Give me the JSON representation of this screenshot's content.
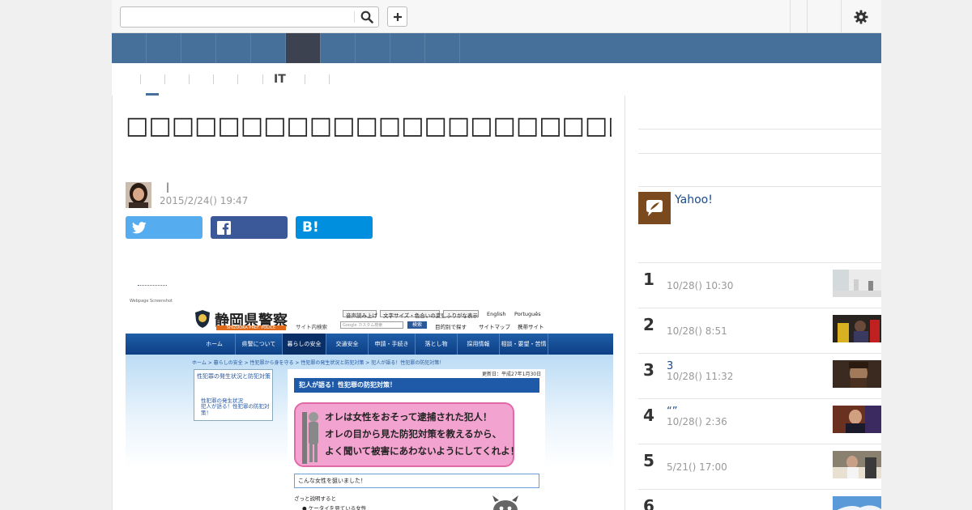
{
  "topbar": {
    "search_placeholder": "",
    "search_icon": "search-icon",
    "add_icon": "plus-icon",
    "settings_icon": "gear-icon"
  },
  "bluenav": {
    "active_index": 5,
    "cell_count": 10
  },
  "subnav": {
    "items": [
      "",
      "",
      "",
      "",
      "",
      "IT",
      ""
    ]
  },
  "article": {
    "title": "□□□□□□□□□□□□□□□□□□□□□□□□□□□□□□□□□",
    "author_divider": "|",
    "date": "2015/2/24() 19:47",
    "share_buttons": {
      "twitter_icon": "twitter-icon",
      "facebook_icon": "facebook-icon",
      "hatena_label": "B!"
    },
    "embedded_screenshot": {
      "caption": "Webpage Screenshot",
      "site_title": "静岡県警察",
      "site_subtitle": "SHIZUOKA PREF. POLICE",
      "util_links": [
        "音声読み上げ",
        "文字サイズ・色合いの変更",
        "ふりがな表示",
        "English",
        "Português"
      ],
      "search_label": "サイト内検索",
      "search_placeholder": "Google カスタム検索",
      "search_button": "検索",
      "util_links2": [
        "目的別で探す",
        "サイトマップ",
        "携帯サイト"
      ],
      "tabs": [
        "ホーム",
        "県警について",
        "暮らしの安全",
        "交通安全",
        "申請・手続き",
        "落とし物",
        "採用情報",
        "相談・要望・苦情"
      ],
      "selected_tab": 2,
      "breadcrumb": "ホーム > 暮らしの安全 > 性犯罪から身を守る > 性犯罪の発生状況と防犯対策 > 犯人が語る！性犯罪の防犯対策！",
      "side_heading": "性犯罪の発生状況と防犯対策",
      "side_links": [
        "性犯罪の発生状況",
        "犯人が語る！性犯罪の防犯対策！"
      ],
      "updated": "更新日：平成27年1月30日",
      "main_heading": "犯人が語る！性犯罪の防犯対策！",
      "pink_lines": [
        "オレは女性をおそって逮捕された犯人！",
        "オレの目から見た防犯対策を教えるから、",
        "よく聞いて被害にあわないようにしてくれよ！"
      ],
      "sub_heading": "こんな女性を狙いました！",
      "para1": "ざっと説明すると",
      "para2": "● ケータイを見ている女性"
    }
  },
  "sidebar": {
    "yahoo_label": "Yahoo!",
    "yahoo_icon": "feather-icon",
    "ranking": [
      {
        "num": "1",
        "title": "",
        "date": "10/28() 10:30",
        "thumb_colors": [
          "#e8e8e8",
          "#cfd6d8"
        ]
      },
      {
        "num": "2",
        "title": "",
        "date": "10/28() 8:51",
        "thumb_colors": [
          "#1a1a1a",
          "#d8b020"
        ]
      },
      {
        "num": "3",
        "title": "3",
        "date": "10/28() 11:32",
        "thumb_colors": [
          "#3a2a20",
          "#8a6a50"
        ]
      },
      {
        "num": "4",
        "title": "“”",
        "date": "10/28() 2:36",
        "thumb_colors": [
          "#5a2a20",
          "#c08a70"
        ]
      },
      {
        "num": "5",
        "title": "",
        "date": "5/21() 17:00",
        "thumb_colors": [
          "#6a6050",
          "#e8e0d0"
        ]
      },
      {
        "num": "6",
        "title": "",
        "date": "",
        "thumb_colors": [
          "#4a8ac8",
          "#dfeaf4"
        ]
      }
    ]
  }
}
